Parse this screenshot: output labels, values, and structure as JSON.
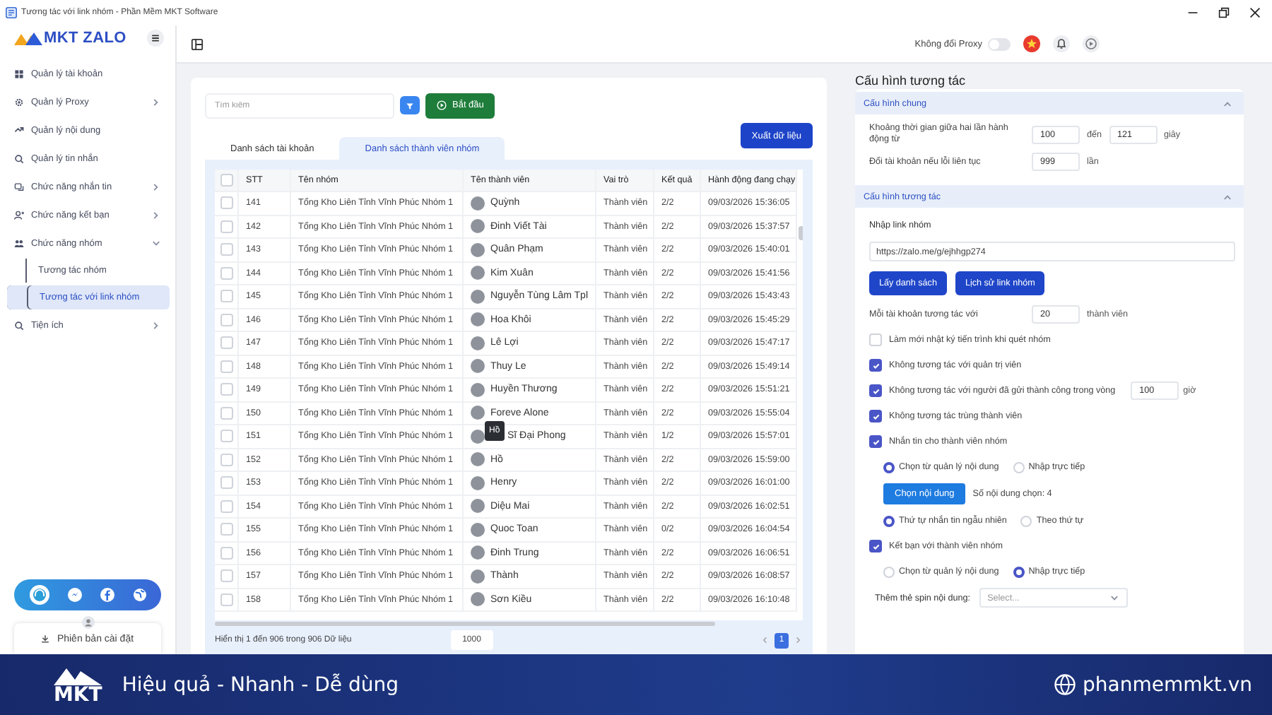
{
  "window": {
    "title": "Tương tác với link nhóm - Phần Mềm MKT Software"
  },
  "sidebar": {
    "logo": "MKT ZALO",
    "items": [
      {
        "label": "Quản lý tài khoản",
        "selected": false
      },
      {
        "label": "Quản lý Proxy",
        "selected": false,
        "expanded": false
      },
      {
        "label": "Quản lý nội dung",
        "selected": false
      },
      {
        "label": "Quản lý tin nhắn",
        "selected": false
      },
      {
        "label": "Chức năng nhắn tin",
        "selected": false,
        "expanded": false
      },
      {
        "label": "Chức năng kết bạn",
        "selected": false,
        "expanded": false
      },
      {
        "label": "Chức năng nhóm",
        "selected": false,
        "expanded": true,
        "children": [
          {
            "label": "Tương tác nhóm",
            "selected": false
          },
          {
            "label": "Tương tác với link nhóm",
            "selected": true
          }
        ]
      },
      {
        "label": "Tiện ích",
        "selected": false,
        "expanded": false
      }
    ],
    "version_button": "Phiên bản cài đặt"
  },
  "topbar": {
    "proxy_toggle": {
      "label": "Không đổi Proxy",
      "on": false
    }
  },
  "main": {
    "search": {
      "placeholder": "Tìm kiếm"
    },
    "start_button": "Bắt đầu",
    "export_button": "Xuất dữ liệu",
    "tabs": [
      {
        "label": "Danh sách tài khoản",
        "selected": false
      },
      {
        "label": "Danh sách thành viên nhóm",
        "selected": true
      }
    ],
    "table": {
      "header_checked": false,
      "columns": [
        "STT",
        "Tên nhóm",
        "Tên thành viên",
        "Vai trò",
        "Kết quả",
        "Hành động đang chạy"
      ],
      "rows": [
        {
          "checked": false,
          "cells": [
            "141",
            "Tổng Kho Liên Tỉnh Vĩnh Phúc Nhóm 1",
            "Quỳnh",
            "Thành viên",
            "2/2",
            "09/03/2026 15:36:05"
          ]
        },
        {
          "checked": false,
          "cells": [
            "142",
            "Tổng Kho Liên Tỉnh Vĩnh Phúc Nhóm 1",
            "Đinh Viết Tài",
            "Thành viên",
            "2/2",
            "09/03/2026 15:37:57"
          ]
        },
        {
          "checked": false,
          "cells": [
            "143",
            "Tổng Kho Liên Tỉnh Vĩnh Phúc Nhóm 1",
            "Quân Phạm",
            "Thành viên",
            "2/2",
            "09/03/2026 15:40:01"
          ]
        },
        {
          "checked": false,
          "cells": [
            "144",
            "Tổng Kho Liên Tỉnh Vĩnh Phúc Nhóm 1",
            "Kim Xuân",
            "Thành viên",
            "2/2",
            "09/03/2026 15:41:56"
          ]
        },
        {
          "checked": false,
          "cells": [
            "145",
            "Tổng Kho Liên Tỉnh Vĩnh Phúc Nhóm 1",
            "Nguyễn Tùng Lâm Tpl",
            "Thành viên",
            "2/2",
            "09/03/2026 15:43:43"
          ]
        },
        {
          "checked": false,
          "cells": [
            "146",
            "Tổng Kho Liên Tỉnh Vĩnh Phúc Nhóm 1",
            "Hoa Khôi",
            "Thành viên",
            "2/2",
            "09/03/2026 15:45:29"
          ]
        },
        {
          "checked": false,
          "cells": [
            "147",
            "Tổng Kho Liên Tỉnh Vĩnh Phúc Nhóm 1",
            "Lê Lợi",
            "Thành viên",
            "2/2",
            "09/03/2026 15:47:17"
          ]
        },
        {
          "checked": false,
          "cells": [
            "148",
            "Tổng Kho Liên Tỉnh Vĩnh Phúc Nhóm 1",
            "Thuy Le",
            "Thành viên",
            "2/2",
            "09/03/2026 15:49:14"
          ]
        },
        {
          "checked": false,
          "cells": [
            "149",
            "Tổng Kho Liên Tỉnh Vĩnh Phúc Nhóm 1",
            "Huyền Thương",
            "Thành viên",
            "2/2",
            "09/03/2026 15:51:21"
          ]
        },
        {
          "checked": false,
          "cells": [
            "150",
            "Tổng Kho Liên Tỉnh Vĩnh Phúc Nhóm 1",
            "Foreve Alone",
            "Thành viên",
            "2/2",
            "09/03/2026 15:55:04"
          ]
        },
        {
          "checked": false,
          "tooltip": "Hồ",
          "cells": [
            "151",
            "Tổng Kho Liên Tỉnh Vĩnh Phúc Nhóm 1",
            "Sĩ Đại Phong",
            "Thành viên",
            "1/2",
            "09/03/2026 15:57:01"
          ]
        },
        {
          "checked": false,
          "cells": [
            "152",
            "Tổng Kho Liên Tỉnh Vĩnh Phúc Nhóm 1",
            "Hồ",
            "Thành viên",
            "2/2",
            "09/03/2026 15:59:00"
          ]
        },
        {
          "checked": false,
          "cells": [
            "153",
            "Tổng Kho Liên Tỉnh Vĩnh Phúc Nhóm 1",
            "Henry",
            "Thành viên",
            "2/2",
            "09/03/2026 16:01:00"
          ]
        },
        {
          "checked": false,
          "cells": [
            "154",
            "Tổng Kho Liên Tỉnh Vĩnh Phúc Nhóm 1",
            "Diệu Mai",
            "Thành viên",
            "2/2",
            "09/03/2026 16:02:51"
          ]
        },
        {
          "checked": false,
          "cells": [
            "155",
            "Tổng Kho Liên Tỉnh Vĩnh Phúc Nhóm 1",
            "Quoc Toan",
            "Thành viên",
            "0/2",
            "09/03/2026 16:04:54"
          ]
        },
        {
          "checked": false,
          "cells": [
            "156",
            "Tổng Kho Liên Tỉnh Vĩnh Phúc Nhóm 1",
            "Đinh Trung",
            "Thành viên",
            "2/2",
            "09/03/2026 16:06:51"
          ]
        },
        {
          "checked": false,
          "cells": [
            "157",
            "Tổng Kho Liên Tỉnh Vĩnh Phúc Nhóm 1",
            "Thành",
            "Thành viên",
            "2/2",
            "09/03/2026 16:08:57"
          ]
        },
        {
          "checked": false,
          "cells": [
            "158",
            "Tổng Kho Liên Tỉnh Vĩnh Phúc Nhóm 1",
            "Sơn Kiều",
            "Thành viên",
            "2/2",
            "09/03/2026 16:10:48"
          ]
        }
      ]
    },
    "footer": {
      "summary": "Hiển thị 1 đến 906 trong 906 Dữ liệu",
      "page_size": "1000",
      "pages": [
        {
          "label": "1",
          "selected": true
        }
      ]
    }
  },
  "config": {
    "title": "Cấu hình tương tác",
    "sections": [
      {
        "title": "Cấu hình chung",
        "expanded": true,
        "rows": [
          {
            "kind": "range",
            "label": "Khoảng thời gian giữa hai lần hành động từ",
            "from": "100",
            "to_label": "đến",
            "to": "121",
            "unit": "giây"
          },
          {
            "kind": "number",
            "label": "Đổi tài khoản nếu lỗi liên tục",
            "value": "999",
            "unit": "lần"
          }
        ]
      },
      {
        "title": "Cấu hình tương tác",
        "expanded": true,
        "rows": [
          {
            "kind": "field_label",
            "text": "Nhập link nhóm"
          },
          {
            "kind": "text_input",
            "value": "https://zalo.me/g/ejhhgp274"
          },
          {
            "kind": "buttons",
            "labels": [
              "Lấy danh sách",
              "Lịch sử link nhóm"
            ]
          },
          {
            "kind": "number",
            "label": "Mỗi tài khoản tương tác với",
            "value": "20",
            "unit": "thành viên"
          },
          {
            "kind": "checkbox",
            "label": "Làm mới nhật ký tiến trình khi quét nhóm",
            "checked": false
          },
          {
            "kind": "checkbox",
            "label": "Không tương tác với quản trị viên",
            "checked": true
          },
          {
            "kind": "checkbox",
            "label": "Không tương tác với người đã gửi thành công trong vòng",
            "checked": true,
            "value": "100",
            "unit": "giờ"
          },
          {
            "kind": "checkbox",
            "label": "Không tương tác trùng thành viên",
            "checked": true
          },
          {
            "kind": "checkbox",
            "label": "Nhắn tin cho thành viên nhóm",
            "checked": true
          },
          {
            "kind": "radio_group",
            "options": [
              {
                "label": "Chọn từ quản lý nội dung",
                "selected": true
              },
              {
                "label": "Nhập trực tiếp",
                "selected": false
              }
            ]
          },
          {
            "kind": "button_note",
            "button": "Chọn nội dung",
            "note": "Số nội dung chọn: 4"
          },
          {
            "kind": "radio_group",
            "options": [
              {
                "label": "Thứ tự nhắn tin ngẫu nhiên",
                "selected": true
              },
              {
                "label": "Theo thứ tự",
                "selected": false
              }
            ]
          },
          {
            "kind": "checkbox",
            "label": "Kết bạn với thành viên nhóm",
            "checked": true
          },
          {
            "kind": "radio_group",
            "options": [
              {
                "label": "Chọn từ quản lý nội dung",
                "selected": false
              },
              {
                "label": "Nhập trực tiếp",
                "selected": true
              }
            ]
          },
          {
            "kind": "select",
            "label": "Thêm thẻ spin nội dung:",
            "placeholder": "Select..."
          }
        ]
      }
    ]
  },
  "banner": {
    "logo": "MKT",
    "tagline": "Hiệu quả - Nhanh - Dễ dùng",
    "website": "phanmemmkt.vn"
  }
}
